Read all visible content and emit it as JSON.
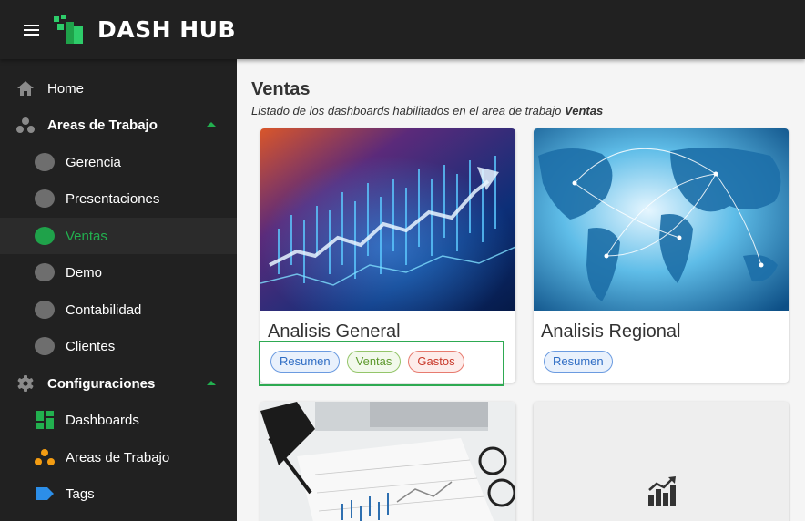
{
  "app": {
    "brand": "DASH HUB",
    "accent_color": "#22b04f"
  },
  "sidebar": {
    "items": [
      {
        "label": "Home",
        "icon": "home-icon"
      },
      {
        "label": "Areas de Trabajo",
        "icon": "workspaces-icon",
        "expanded": true
      },
      {
        "label": "Gerencia",
        "icon": "circle-icon"
      },
      {
        "label": "Presentaciones",
        "icon": "circle-icon"
      },
      {
        "label": "Ventas",
        "icon": "circle-icon",
        "active": true
      },
      {
        "label": "Demo",
        "icon": "circle-icon"
      },
      {
        "label": "Contabilidad",
        "icon": "circle-icon"
      },
      {
        "label": "Clientes",
        "icon": "circle-icon"
      },
      {
        "label": "Configuraciones",
        "icon": "gear-icon",
        "expanded": true
      },
      {
        "label": "Dashboards",
        "icon": "dashboard-grid-icon"
      },
      {
        "label": "Areas de Trabajo",
        "icon": "workspaces-icon"
      },
      {
        "label": "Tags",
        "icon": "tag-icon"
      }
    ]
  },
  "main": {
    "title": "Ventas",
    "subtitle_prefix": "Listado de los dashboards habilitados en el area de trabajo",
    "subtitle_area": "Ventas",
    "cards": [
      {
        "title": "Analisis General",
        "image": "financial-chart-image",
        "tags": [
          "Resumen",
          "Ventas",
          "Gastos"
        ]
      },
      {
        "title": "Analisis Regional",
        "image": "world-map-image",
        "tags": [
          "Resumen"
        ]
      },
      {
        "title": "",
        "image": "desk-documents-image",
        "tags": []
      },
      {
        "title": "",
        "image": "bar-chart-placeholder-icon",
        "tags": []
      }
    ]
  }
}
